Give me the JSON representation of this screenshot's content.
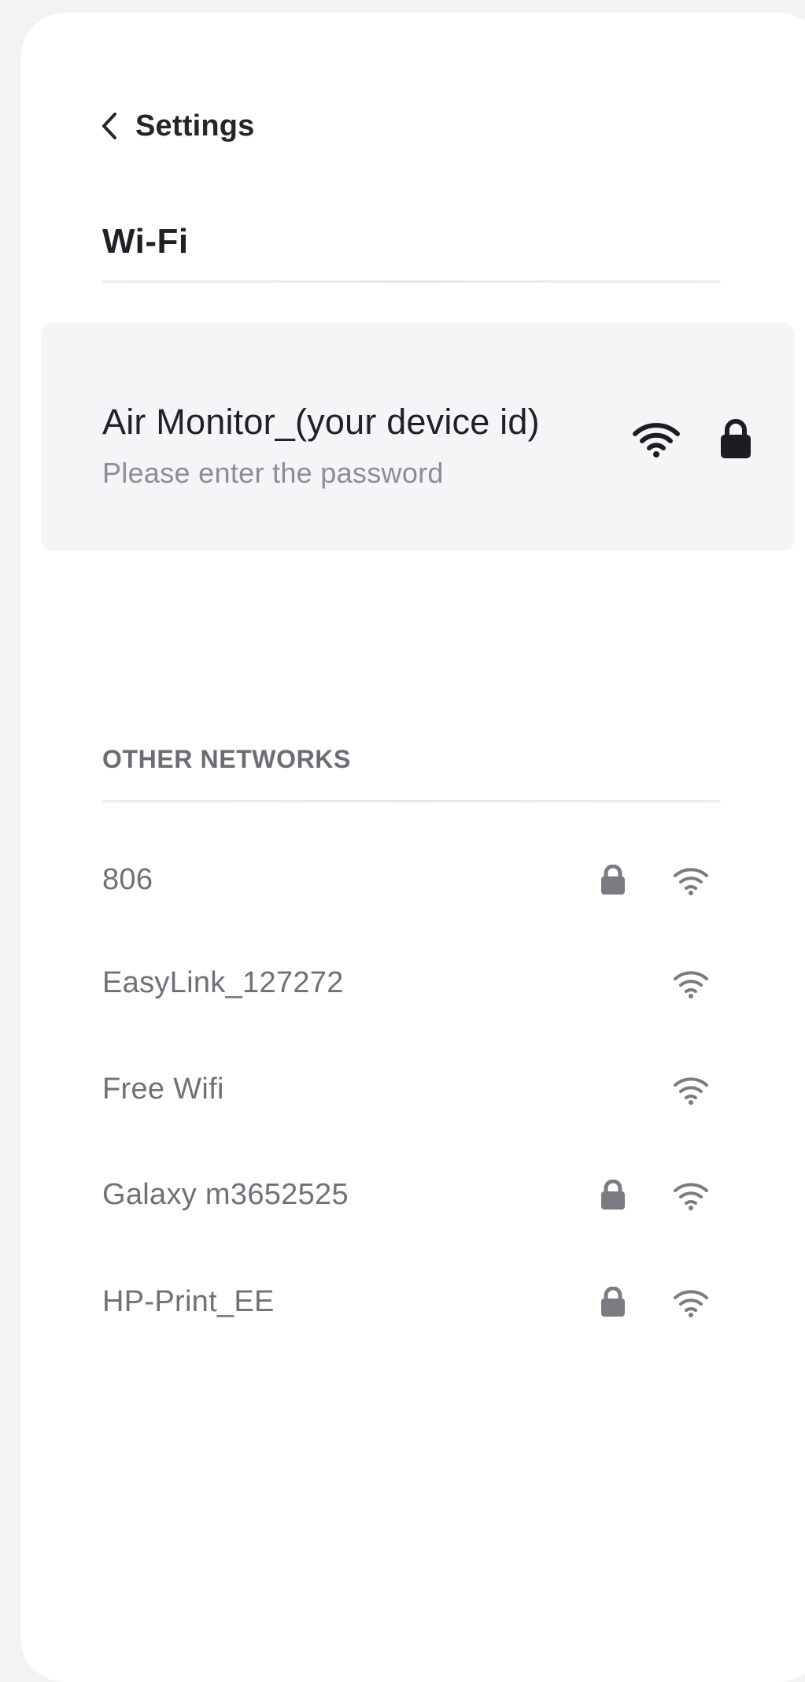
{
  "header": {
    "back_label": "Settings",
    "title": "Wi-Fi"
  },
  "current_network": {
    "name": "Air Monitor_(your device id)",
    "subtitle": "Please enter the password",
    "wifi_icon": "wifi-icon",
    "lock_icon": "lock-icon"
  },
  "other_networks": {
    "label": "OTHER NETWORKS",
    "items": [
      {
        "name": "806",
        "secured": true
      },
      {
        "name": "EasyLink_127272",
        "secured": false
      },
      {
        "name": "Free Wifi",
        "secured": false
      },
      {
        "name": "Galaxy m3652525",
        "secured": true
      },
      {
        "name": "HP-Print_EE",
        "secured": true
      }
    ]
  },
  "colors": {
    "background": "#f3f3f4",
    "card": "#ffffff",
    "highlight": "#f4f5f7",
    "primary_text": "#202127",
    "secondary_text": "#8c8e94",
    "network_text": "#6f7177",
    "icon_muted": "#7a7c82"
  }
}
